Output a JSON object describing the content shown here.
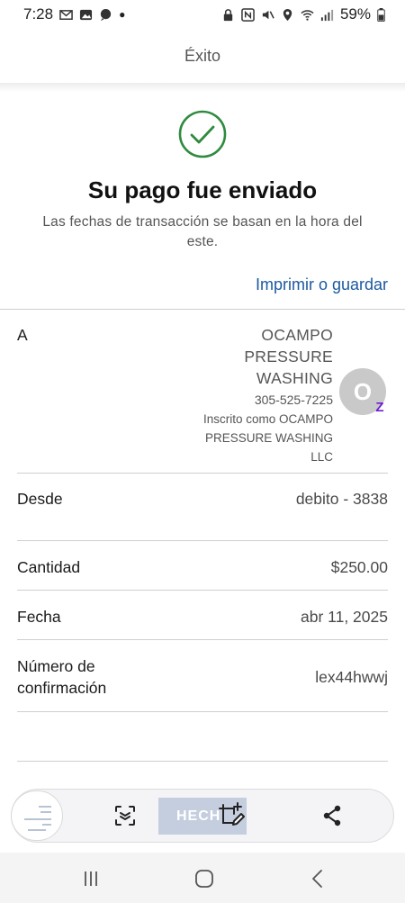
{
  "status_bar": {
    "time": "7:28",
    "battery": "59%"
  },
  "header": {
    "title": "Éxito"
  },
  "success": {
    "title": "Su pago fue enviado",
    "subtitle": "Las fechas de transacción se basan en la hora del este."
  },
  "print_link": "Imprimir o guardar",
  "recipient": {
    "label": "A",
    "name_lines": [
      "OCAMPO",
      "PRESSURE",
      "WASHING"
    ],
    "phone": "305-525-7225",
    "registered_lines": [
      "Inscrito como OCAMPO",
      "PRESSURE WASHING",
      "LLC"
    ],
    "avatar_initial": "O",
    "badge": "Z"
  },
  "details": {
    "from_label": "Desde",
    "from_value": "debito - 3838",
    "amount_label": "Cantidad",
    "amount_value": "$250.00",
    "date_label": "Fecha",
    "date_value": "abr 11, 2025",
    "confirmation_label_lines": [
      "Número de",
      "confirmación"
    ],
    "confirmation_value": "lex44hwwj"
  },
  "toolbar": {
    "done_label": "HECH"
  },
  "colors": {
    "accent_green": "#2e8b3e",
    "link_blue": "#1b5aa0",
    "zelle_purple": "#6d1ed4"
  }
}
